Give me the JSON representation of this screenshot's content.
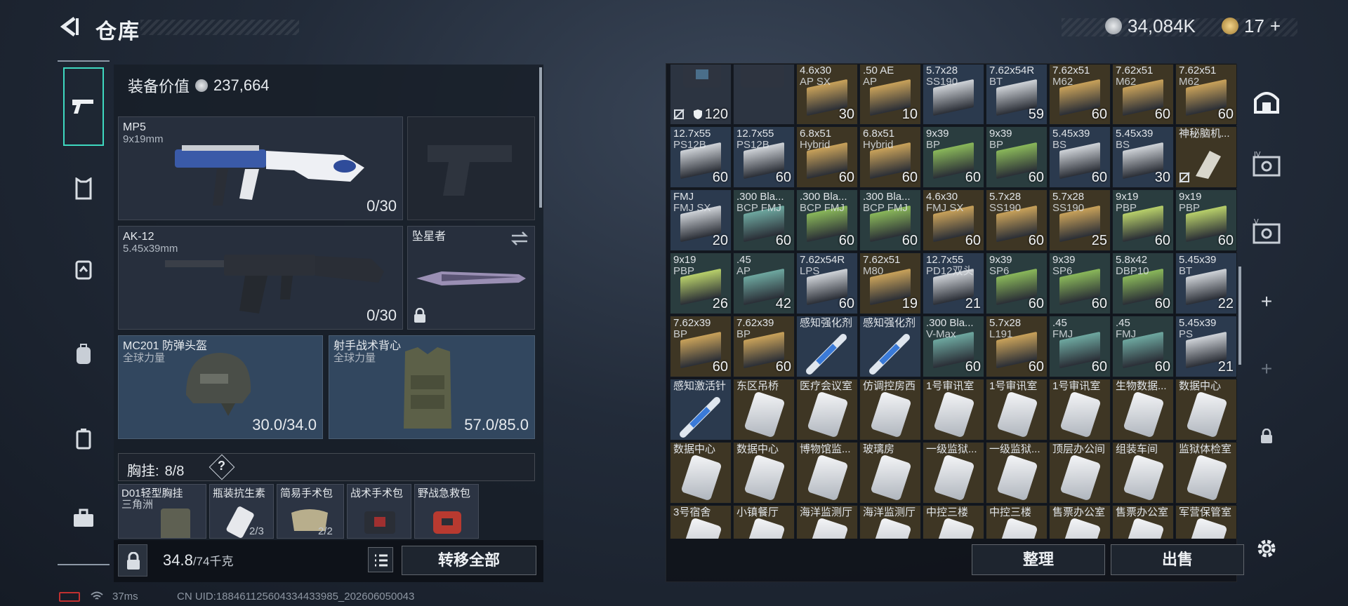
{
  "header": {
    "title": "仓库",
    "currency_silver": "34,084K",
    "currency_gold": "17",
    "add_label": "+"
  },
  "left_nav": {
    "items": [
      "weapon-icon",
      "bow-armor-icon",
      "backpack-icon",
      "bag-icon",
      "case-icon",
      "toolbox-icon"
    ]
  },
  "loadout": {
    "worth_label": "装备价值",
    "worth_value": "237,664",
    "primary": {
      "name": "MP5",
      "caliber": "9x19mm",
      "ammo": "0/30"
    },
    "sidearm": {
      "name": ""
    },
    "secondary": {
      "name": "AK-12",
      "caliber": "5.45x39mm",
      "ammo": "0/30"
    },
    "melee": {
      "name": "坠星者"
    },
    "helmet": {
      "name": "MC201 防弹头盔",
      "faction": "全球力量",
      "durability": "30.0/34.0"
    },
    "vest": {
      "name": "射手战术背心",
      "faction": "全球力量",
      "durability": "57.0/85.0"
    },
    "rig": {
      "label": "胸挂:",
      "count": "8/8",
      "help": "?"
    },
    "rig_items": [
      {
        "name": "D01轻型胸挂",
        "sub": "三角洲"
      },
      {
        "name": "瓶装抗生素",
        "sub": "2/3"
      },
      {
        "name": "简易手术包",
        "sub": "2/2"
      },
      {
        "name": "战术手术包",
        "sub": ""
      },
      {
        "name": "野战急救包",
        "sub": ""
      }
    ],
    "weight": "34.8",
    "weight_max": "/74千克",
    "transfer_all": "转移全部"
  },
  "stash": {
    "rows": [
      [
        {
          "n1": "",
          "n2": "",
          "q": "120",
          "kind": "rig"
        },
        {
          "n1": "",
          "n2": "",
          "q": "",
          "kind": "rig2"
        },
        {
          "n1": "4.6x30",
          "n2": "AP SX",
          "q": "30",
          "kind": "ammo-gold"
        },
        {
          "n1": ".50 AE",
          "n2": "AP",
          "q": "10",
          "kind": "ammo-gold"
        },
        {
          "n1": "5.7x28",
          "n2": "SS190",
          "q": "",
          "kind": "ammo-white"
        },
        {
          "n1": "7.62x54R",
          "n2": "BT",
          "q": "59",
          "kind": "ammo-white"
        },
        {
          "n1": "7.62x51",
          "n2": "M62",
          "q": "60",
          "kind": "ammo-gold"
        },
        {
          "n1": "7.62x51",
          "n2": "M62",
          "q": "60",
          "kind": "ammo-gold"
        },
        {
          "n1": "7.62x51",
          "n2": "M62",
          "q": "60",
          "kind": "ammo-gold"
        }
      ],
      [
        {
          "n1": "12.7x55",
          "n2": "PS12B",
          "q": "60",
          "kind": "ammo-white"
        },
        {
          "n1": "12.7x55",
          "n2": "PS12B",
          "q": "60",
          "kind": "ammo-white"
        },
        {
          "n1": "6.8x51",
          "n2": "Hybrid",
          "q": "60",
          "kind": "ammo-gold"
        },
        {
          "n1": "6.8x51",
          "n2": "Hybrid",
          "q": "60",
          "kind": "ammo-gold"
        },
        {
          "n1": "9x39",
          "n2": "BP",
          "q": "60",
          "kind": "ammo-green"
        },
        {
          "n1": "9x39",
          "n2": "BP",
          "q": "60",
          "kind": "ammo-green"
        },
        {
          "n1": "5.45x39",
          "n2": "BS",
          "q": "60",
          "kind": "ammo-white"
        },
        {
          "n1": "5.45x39",
          "n2": "BS",
          "q": "30",
          "kind": "ammo-white"
        },
        {
          "n1": "神秘脑机...",
          "n2": "",
          "q": "",
          "kind": "device"
        }
      ],
      [
        {
          "n1": "FMJ",
          "n2": "FMJ SX",
          "q": "20",
          "kind": "ammo-white"
        },
        {
          "n1": ".300 Bla...",
          "n2": "BCP FMJ",
          "q": "60",
          "kind": "ammo-teal"
        },
        {
          "n1": ".300 Bla...",
          "n2": "BCP FMJ",
          "q": "60",
          "kind": "ammo-green"
        },
        {
          "n1": ".300 Bla...",
          "n2": "BCP FMJ",
          "q": "60",
          "kind": "ammo-green"
        },
        {
          "n1": "4.6x30",
          "n2": "FMJ SX",
          "q": "60",
          "kind": "ammo-gold"
        },
        {
          "n1": "5.7x28",
          "n2": "SS190",
          "q": "60",
          "kind": "ammo-gold"
        },
        {
          "n1": "5.7x28",
          "n2": "SS190",
          "q": "25",
          "kind": "ammo-gold"
        },
        {
          "n1": "9x19",
          "n2": "PBP",
          "q": "60",
          "kind": "ammo-lime"
        },
        {
          "n1": "9x19",
          "n2": "PBP",
          "q": "60",
          "kind": "ammo-lime"
        }
      ],
      [
        {
          "n1": "9x19",
          "n2": "PBP",
          "q": "26",
          "kind": "ammo-lime"
        },
        {
          "n1": ".45",
          "n2": "AP",
          "q": "42",
          "kind": "ammo-teal"
        },
        {
          "n1": "7.62x54R",
          "n2": "LPS",
          "q": "60",
          "kind": "ammo-white"
        },
        {
          "n1": "7.62x51",
          "n2": "M80",
          "q": "19",
          "kind": "ammo-gold"
        },
        {
          "n1": "12.7x55",
          "n2": "PD12双头",
          "q": "21",
          "kind": "ammo-white"
        },
        {
          "n1": "9x39",
          "n2": "SP6",
          "q": "60",
          "kind": "ammo-green"
        },
        {
          "n1": "9x39",
          "n2": "SP6",
          "q": "60",
          "kind": "ammo-green"
        },
        {
          "n1": "5.8x42",
          "n2": "DBP10",
          "q": "60",
          "kind": "ammo-green"
        },
        {
          "n1": "5.45x39",
          "n2": "BT",
          "q": "22",
          "kind": "ammo-white"
        }
      ],
      [
        {
          "n1": "7.62x39",
          "n2": "BP",
          "q": "60",
          "kind": "ammo-gold"
        },
        {
          "n1": "7.62x39",
          "n2": "BP",
          "q": "60",
          "kind": "ammo-gold"
        },
        {
          "n1": "感知强化剂",
          "n2": "",
          "q": "",
          "kind": "syringe"
        },
        {
          "n1": "感知强化剂",
          "n2": "",
          "q": "",
          "kind": "syringe"
        },
        {
          "n1": ".300 Bla...",
          "n2": "V-Max",
          "q": "60",
          "kind": "ammo-teal"
        },
        {
          "n1": "5.7x28",
          "n2": "L191",
          "q": "60",
          "kind": "ammo-gold"
        },
        {
          "n1": ".45",
          "n2": "FMJ",
          "q": "60",
          "kind": "ammo-teal"
        },
        {
          "n1": ".45",
          "n2": "FMJ",
          "q": "60",
          "kind": "ammo-teal"
        },
        {
          "n1": "5.45x39",
          "n2": "PS",
          "q": "21",
          "kind": "ammo-white"
        }
      ],
      [
        {
          "n1": "感知激活针",
          "n2": "",
          "q": "",
          "kind": "syringe2"
        },
        {
          "n1": "东区吊桥",
          "n2": "",
          "q": "",
          "kind": "card"
        },
        {
          "n1": "医疗会议室",
          "n2": "",
          "q": "",
          "kind": "card"
        },
        {
          "n1": "仿调控房西",
          "n2": "",
          "q": "",
          "kind": "card"
        },
        {
          "n1": "1号审讯室",
          "n2": "",
          "q": "",
          "kind": "card"
        },
        {
          "n1": "1号审讯室",
          "n2": "",
          "q": "",
          "kind": "card"
        },
        {
          "n1": "1号审讯室",
          "n2": "",
          "q": "",
          "kind": "card"
        },
        {
          "n1": "生物数据...",
          "n2": "",
          "q": "",
          "kind": "card"
        },
        {
          "n1": "数据中心",
          "n2": "",
          "q": "",
          "kind": "card"
        }
      ],
      [
        {
          "n1": "数据中心",
          "n2": "",
          "q": "",
          "kind": "card"
        },
        {
          "n1": "数据中心",
          "n2": "",
          "q": "",
          "kind": "card"
        },
        {
          "n1": "博物馆监...",
          "n2": "",
          "q": "",
          "kind": "card"
        },
        {
          "n1": "玻璃房",
          "n2": "",
          "q": "",
          "kind": "card"
        },
        {
          "n1": "一级监狱...",
          "n2": "",
          "q": "",
          "kind": "card"
        },
        {
          "n1": "一级监狱...",
          "n2": "",
          "q": "",
          "kind": "card"
        },
        {
          "n1": "顶层办公间",
          "n2": "",
          "q": "",
          "kind": "card"
        },
        {
          "n1": "组装车间",
          "n2": "",
          "q": "",
          "kind": "card"
        },
        {
          "n1": "监狱体检室",
          "n2": "",
          "q": "",
          "kind": "card"
        }
      ],
      [
        {
          "n1": "3号宿舍",
          "n2": "",
          "q": "",
          "kind": "card"
        },
        {
          "n1": "小镇餐厅",
          "n2": "",
          "q": "",
          "kind": "card"
        },
        {
          "n1": "海洋监测厅",
          "n2": "",
          "q": "",
          "kind": "card"
        },
        {
          "n1": "海洋监测厅",
          "n2": "",
          "q": "",
          "kind": "card"
        },
        {
          "n1": "中控三楼",
          "n2": "",
          "q": "",
          "kind": "card"
        },
        {
          "n1": "中控三楼",
          "n2": "",
          "q": "",
          "kind": "card"
        },
        {
          "n1": "售票办公室",
          "n2": "",
          "q": "",
          "kind": "card"
        },
        {
          "n1": "售票办公室",
          "n2": "",
          "q": "",
          "kind": "card"
        },
        {
          "n1": "军营保管室",
          "n2": "",
          "q": "",
          "kind": "card"
        }
      ]
    ],
    "sort_label": "整理",
    "sell_label": "出售"
  },
  "right_nav": {
    "iv": "IV",
    "v": "V",
    "plus": "+"
  },
  "status": {
    "ping": "37ms",
    "uid": "CN UID:18846112560433443398​5_202606050043"
  },
  "colors": {
    "accent": "#3ed8c0",
    "gold": "#c9a25a"
  }
}
